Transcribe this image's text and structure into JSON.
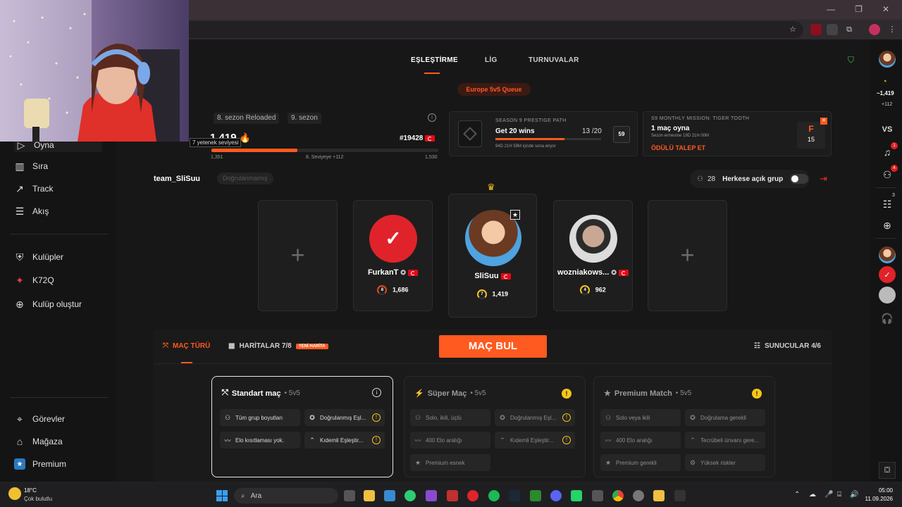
{
  "header": {
    "tabs": [
      {
        "label": "EŞLEŞTİRME"
      },
      {
        "label": "LİG"
      },
      {
        "label": "TURNUVALAR"
      }
    ],
    "queue": "Europe 5v5 Queue"
  },
  "sidebar": {
    "items": [
      {
        "label": "Oyna"
      },
      {
        "label": "Sıra"
      },
      {
        "label": "Track"
      },
      {
        "label": "Akış"
      },
      {
        "label": "Kulüpler"
      },
      {
        "label": "K72Q"
      },
      {
        "label": "Kulüp oluştur"
      },
      {
        "label": "Görevler"
      },
      {
        "label": "Mağaza"
      },
      {
        "label": "Premium"
      }
    ]
  },
  "stats": {
    "season_a": "8. sezon Reloaded",
    "season_b": "9. sezon",
    "elo": "1,419",
    "rank": "#19428",
    "min": "1,351",
    "next_level": "8. Seviyeye +112",
    "max": "1,530",
    "progress": 0.38,
    "tooltip": "7 yetenek seviyesi"
  },
  "prestige": {
    "caption": "SEASON 9 PRESTIGE PATH",
    "title": "Get 20 wins",
    "count": "13 /20",
    "progress": 0.65,
    "timer": "94D 21H 59M içinde sona eriyor",
    "badge": "59"
  },
  "mission": {
    "caption": "S9 MONTHLY MISSION: TIGER TOOTH",
    "title": "1 maç oyna",
    "timer": "Sezon ermesine 19D 21H 00M",
    "claim": "ÖDÜLÜ TALEP ET",
    "reward_letter": "F",
    "reward_count": "15"
  },
  "team": {
    "name": "team_SliSuu",
    "verify": "Doğrulanmamış",
    "group_count": "28",
    "group_label": "Herkese açık grup"
  },
  "players": [
    {
      "name": "FurkanT",
      "level": "8",
      "elo": "1,686"
    },
    {
      "name": "SliSuu",
      "level": "7",
      "elo": "1,419"
    },
    {
      "name": "wozniakows...",
      "level": "4",
      "elo": "962"
    }
  ],
  "bottom": {
    "mode_tab": "MAÇ TÜRÜ",
    "maps_tab": "HARİTALAR 7/8",
    "new_badge": "YENİ HARİTA",
    "find": "MAÇ BUL",
    "servers": "SUNUCULAR 4/6"
  },
  "modes": [
    {
      "title": "Standart maç",
      "sub": "• 5v5",
      "chips": [
        "Tüm grup boyutları",
        "Doğrulanmış Eşl...",
        "Elo kısıtlaması yok.",
        "Kıdemli Eşleştir..."
      ]
    },
    {
      "title": "Süper Maç",
      "sub": "• 5v5",
      "chips": [
        "Solo, ikili, üçlü",
        "Doğrulanmış Eşl...",
        "400 Elo aralığı",
        "Kıdemli Eşleştir...",
        "Premium esnek"
      ]
    },
    {
      "title": "Premium Match",
      "sub": "• 5v5",
      "chips": [
        "Solo veya ikili",
        "Doğrulama gerekli",
        "400 Elo aralığı",
        "Tecrübeli ünvanı gere...",
        "Premium gerekli",
        "Yüksek riskler"
      ]
    }
  ],
  "rail": {
    "elo": "1,419",
    "delta": "+112",
    "vs": "VS",
    "notif_badge": "1",
    "friends_badge": "4",
    "party_badge": "3"
  },
  "taskbar": {
    "temp": "18°C",
    "weather": "Çok bulutlu",
    "search": "Ara",
    "time": "05:00",
    "date": "11.09.2026"
  },
  "colors": {
    "accent": "#ff5a1f",
    "warning": "#f5c518",
    "background": "#141414"
  }
}
